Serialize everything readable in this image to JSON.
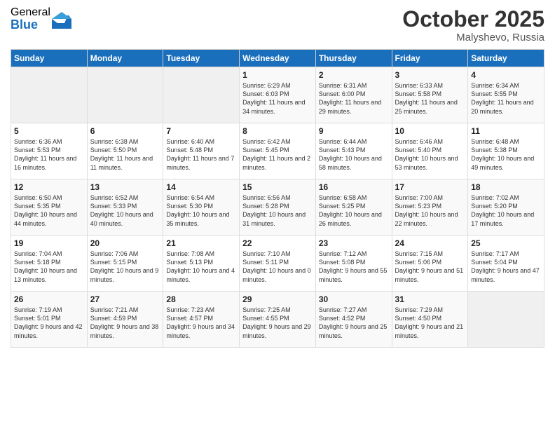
{
  "header": {
    "logo_general": "General",
    "logo_blue": "Blue",
    "month": "October 2025",
    "location": "Malyshevo, Russia"
  },
  "days_of_week": [
    "Sunday",
    "Monday",
    "Tuesday",
    "Wednesday",
    "Thursday",
    "Friday",
    "Saturday"
  ],
  "weeks": [
    [
      {
        "day": "",
        "empty": true
      },
      {
        "day": "",
        "empty": true
      },
      {
        "day": "",
        "empty": true
      },
      {
        "day": "1",
        "sunrise": "6:29 AM",
        "sunset": "6:03 PM",
        "daylight": "11 hours and 34 minutes."
      },
      {
        "day": "2",
        "sunrise": "6:31 AM",
        "sunset": "6:00 PM",
        "daylight": "11 hours and 29 minutes."
      },
      {
        "day": "3",
        "sunrise": "6:33 AM",
        "sunset": "5:58 PM",
        "daylight": "11 hours and 25 minutes."
      },
      {
        "day": "4",
        "sunrise": "6:34 AM",
        "sunset": "5:55 PM",
        "daylight": "11 hours and 20 minutes."
      }
    ],
    [
      {
        "day": "5",
        "sunrise": "6:36 AM",
        "sunset": "5:53 PM",
        "daylight": "11 hours and 16 minutes."
      },
      {
        "day": "6",
        "sunrise": "6:38 AM",
        "sunset": "5:50 PM",
        "daylight": "11 hours and 11 minutes."
      },
      {
        "day": "7",
        "sunrise": "6:40 AM",
        "sunset": "5:48 PM",
        "daylight": "11 hours and 7 minutes."
      },
      {
        "day": "8",
        "sunrise": "6:42 AM",
        "sunset": "5:45 PM",
        "daylight": "11 hours and 2 minutes."
      },
      {
        "day": "9",
        "sunrise": "6:44 AM",
        "sunset": "5:43 PM",
        "daylight": "10 hours and 58 minutes."
      },
      {
        "day": "10",
        "sunrise": "6:46 AM",
        "sunset": "5:40 PM",
        "daylight": "10 hours and 53 minutes."
      },
      {
        "day": "11",
        "sunrise": "6:48 AM",
        "sunset": "5:38 PM",
        "daylight": "10 hours and 49 minutes."
      }
    ],
    [
      {
        "day": "12",
        "sunrise": "6:50 AM",
        "sunset": "5:35 PM",
        "daylight": "10 hours and 44 minutes."
      },
      {
        "day": "13",
        "sunrise": "6:52 AM",
        "sunset": "5:33 PM",
        "daylight": "10 hours and 40 minutes."
      },
      {
        "day": "14",
        "sunrise": "6:54 AM",
        "sunset": "5:30 PM",
        "daylight": "10 hours and 35 minutes."
      },
      {
        "day": "15",
        "sunrise": "6:56 AM",
        "sunset": "5:28 PM",
        "daylight": "10 hours and 31 minutes."
      },
      {
        "day": "16",
        "sunrise": "6:58 AM",
        "sunset": "5:25 PM",
        "daylight": "10 hours and 26 minutes."
      },
      {
        "day": "17",
        "sunrise": "7:00 AM",
        "sunset": "5:23 PM",
        "daylight": "10 hours and 22 minutes."
      },
      {
        "day": "18",
        "sunrise": "7:02 AM",
        "sunset": "5:20 PM",
        "daylight": "10 hours and 17 minutes."
      }
    ],
    [
      {
        "day": "19",
        "sunrise": "7:04 AM",
        "sunset": "5:18 PM",
        "daylight": "10 hours and 13 minutes."
      },
      {
        "day": "20",
        "sunrise": "7:06 AM",
        "sunset": "5:15 PM",
        "daylight": "10 hours and 9 minutes."
      },
      {
        "day": "21",
        "sunrise": "7:08 AM",
        "sunset": "5:13 PM",
        "daylight": "10 hours and 4 minutes."
      },
      {
        "day": "22",
        "sunrise": "7:10 AM",
        "sunset": "5:11 PM",
        "daylight": "10 hours and 0 minutes."
      },
      {
        "day": "23",
        "sunrise": "7:12 AM",
        "sunset": "5:08 PM",
        "daylight": "9 hours and 55 minutes."
      },
      {
        "day": "24",
        "sunrise": "7:15 AM",
        "sunset": "5:06 PM",
        "daylight": "9 hours and 51 minutes."
      },
      {
        "day": "25",
        "sunrise": "7:17 AM",
        "sunset": "5:04 PM",
        "daylight": "9 hours and 47 minutes."
      }
    ],
    [
      {
        "day": "26",
        "sunrise": "7:19 AM",
        "sunset": "5:01 PM",
        "daylight": "9 hours and 42 minutes."
      },
      {
        "day": "27",
        "sunrise": "7:21 AM",
        "sunset": "4:59 PM",
        "daylight": "9 hours and 38 minutes."
      },
      {
        "day": "28",
        "sunrise": "7:23 AM",
        "sunset": "4:57 PM",
        "daylight": "9 hours and 34 minutes."
      },
      {
        "day": "29",
        "sunrise": "7:25 AM",
        "sunset": "4:55 PM",
        "daylight": "9 hours and 29 minutes."
      },
      {
        "day": "30",
        "sunrise": "7:27 AM",
        "sunset": "4:52 PM",
        "daylight": "9 hours and 25 minutes."
      },
      {
        "day": "31",
        "sunrise": "7:29 AM",
        "sunset": "4:50 PM",
        "daylight": "9 hours and 21 minutes."
      },
      {
        "day": "",
        "empty": true
      }
    ]
  ]
}
